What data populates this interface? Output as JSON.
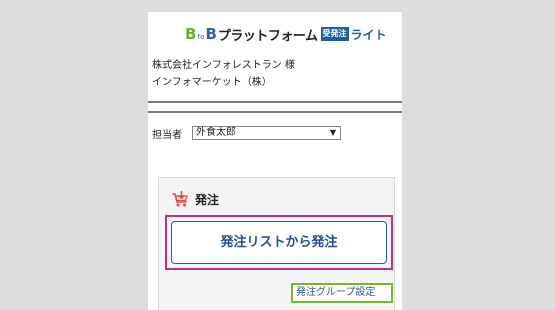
{
  "logo": {
    "b_left": "B",
    "to": "to",
    "b_right": "B",
    "name": "プラットフォーム",
    "badge": "受発注",
    "lite": "ライト"
  },
  "company": {
    "line1": "株式会社インフォレストラン 様",
    "line2": "インフォマーケット（株）"
  },
  "person": {
    "label": "担当者",
    "selected": "外食太郎"
  },
  "order": {
    "icon": "cart-download-icon",
    "title": "発注",
    "main_button": "発注リストから発注",
    "group_link": "発注グループ設定"
  },
  "colors": {
    "background": "#dcdcdc",
    "brand_green": "#67b32e",
    "brand_blue": "#1f5ea8",
    "highlight_red": "#c32f7a",
    "highlight_green": "#76b82a",
    "cart_icon": "#e8473c"
  }
}
